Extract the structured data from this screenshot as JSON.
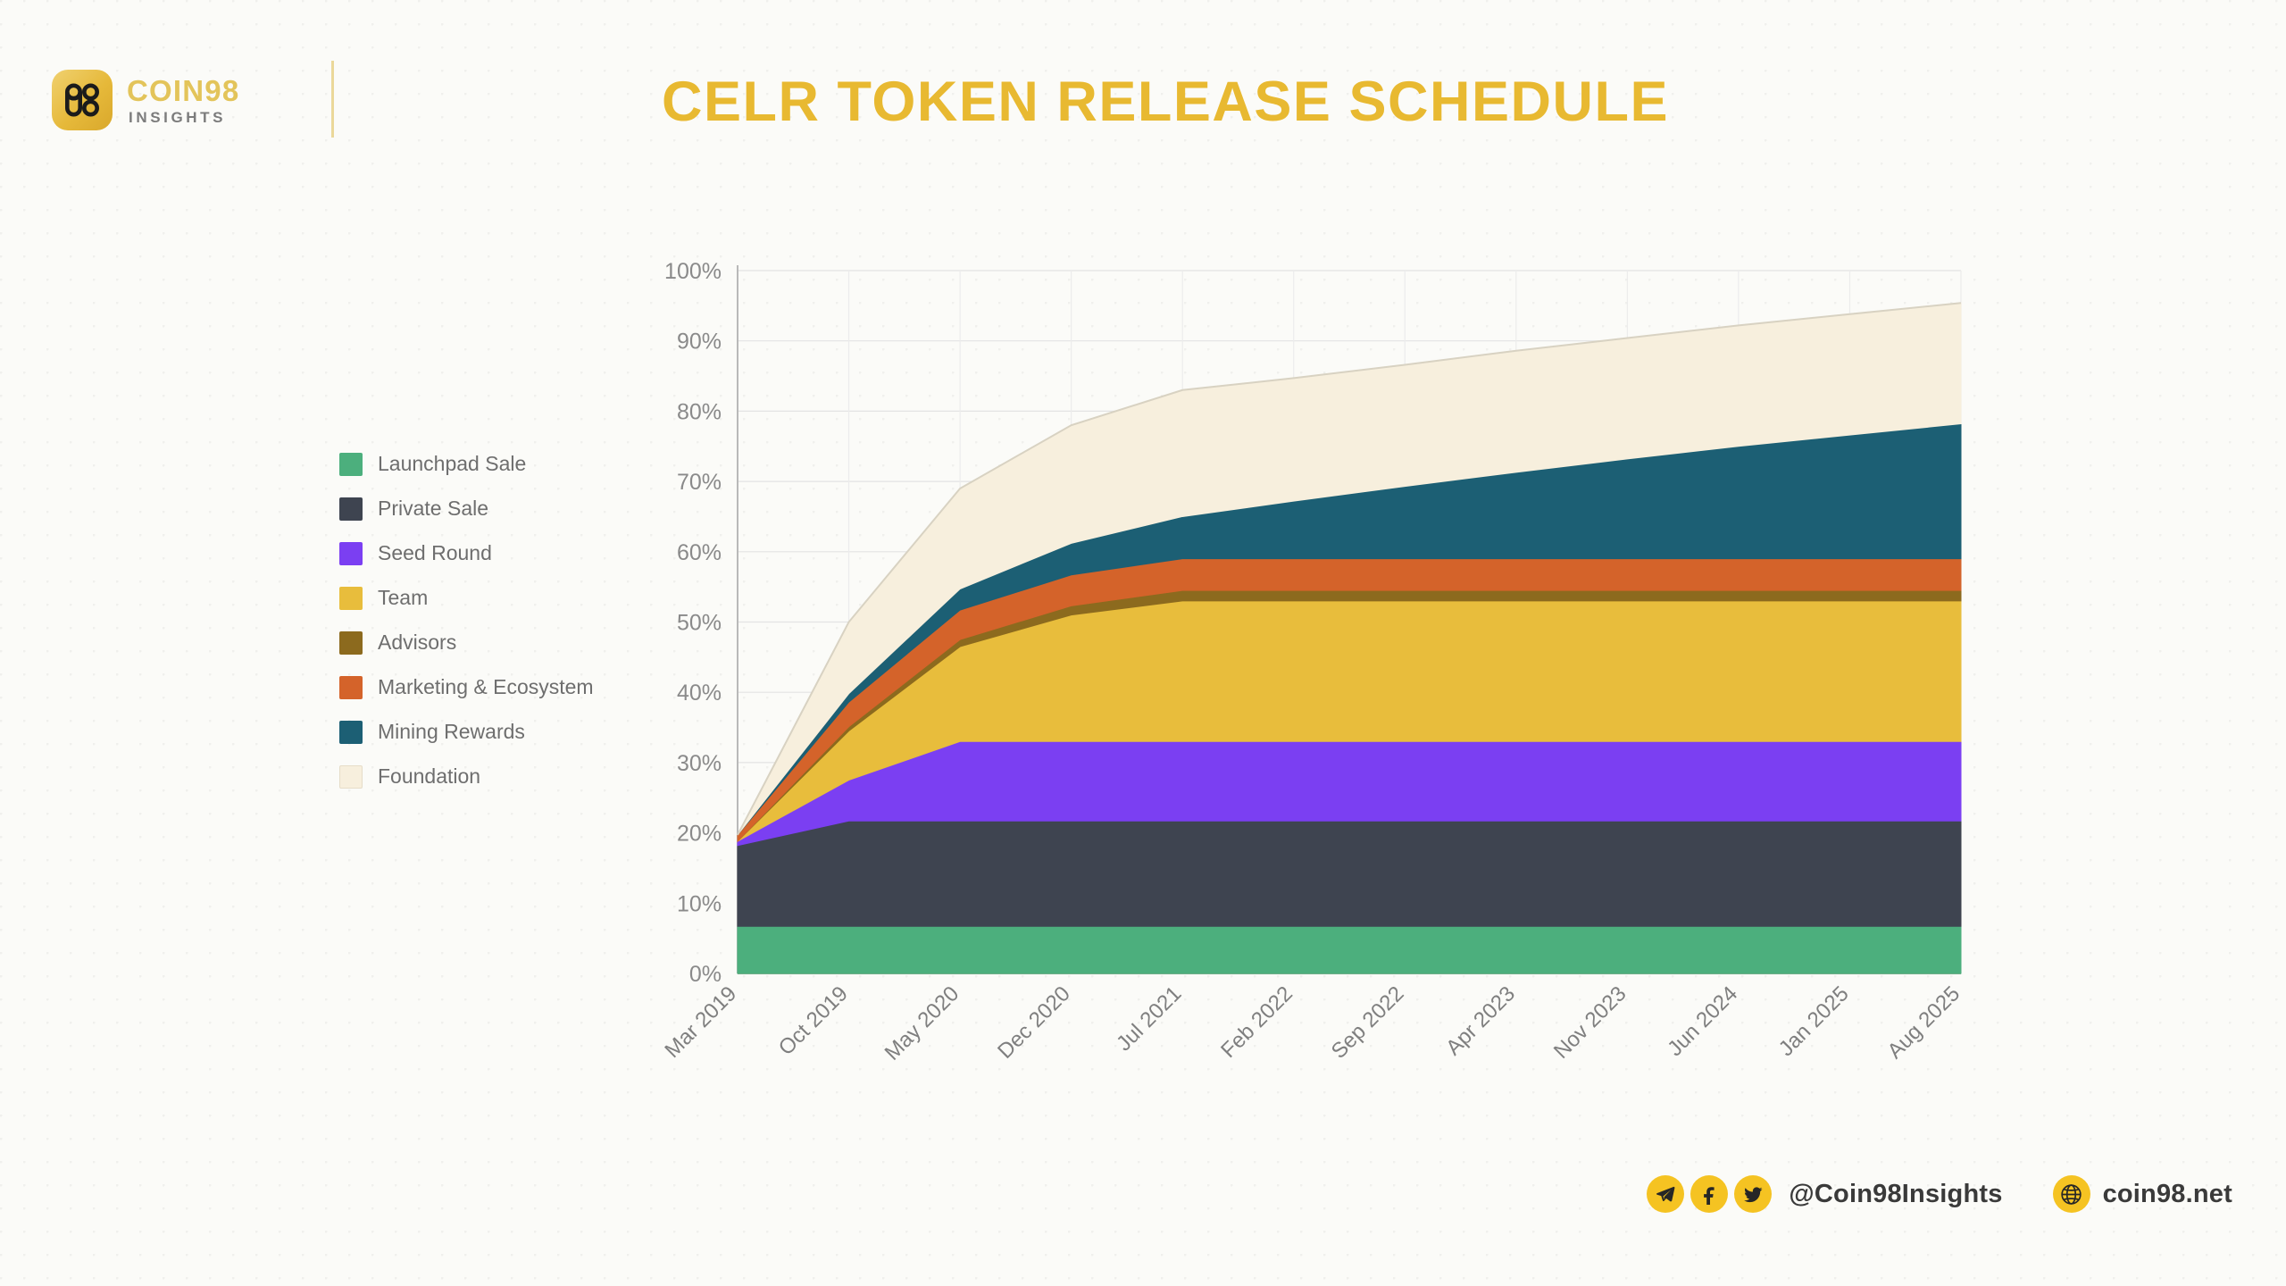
{
  "brand": {
    "mark_icon": "coin98-logo-icon",
    "name": "COIN98",
    "sub": "INSIGHTS"
  },
  "header": {
    "title": "CELR TOKEN RELEASE SCHEDULE",
    "title_color": "#E8B931"
  },
  "legend": {
    "position": "left",
    "items": [
      {
        "label": "Launchpad Sale",
        "color": "#4CAF7D"
      },
      {
        "label": "Private Sale",
        "color": "#3E4450"
      },
      {
        "label": "Seed Round",
        "color": "#7B3FF2"
      },
      {
        "label": "Team",
        "color": "#E8BD3C"
      },
      {
        "label": "Advisors",
        "color": "#8C6A1E"
      },
      {
        "label": "Marketing & Ecosystem",
        "color": "#D4632A"
      },
      {
        "label": "Mining Rewards",
        "color": "#1C5F74"
      },
      {
        "label": "Foundation",
        "color": "#F7EFDD"
      }
    ]
  },
  "footer": {
    "social_icons": [
      {
        "name": "telegram-icon",
        "glyph": "telegram"
      },
      {
        "name": "facebook-icon",
        "glyph": "facebook"
      },
      {
        "name": "twitter-icon",
        "glyph": "twitter"
      }
    ],
    "handle": "@Coin98Insights",
    "globe_icon": "globe-icon",
    "website": "coin98.net",
    "badge_color": "#F5C322"
  },
  "chart_data": {
    "type": "area",
    "stacked": true,
    "title": "CELR TOKEN RELEASE SCHEDULE",
    "xlabel": "",
    "ylabel": "",
    "ylim": [
      0,
      100
    ],
    "yticks": [
      0,
      10,
      20,
      30,
      40,
      50,
      60,
      70,
      80,
      90,
      100
    ],
    "ytick_labels": [
      "0%",
      "10%",
      "20%",
      "30%",
      "40%",
      "50%",
      "60%",
      "70%",
      "80%",
      "90%",
      "100%"
    ],
    "grid": true,
    "legend_position": "left-outside",
    "x": [
      "Mar 2019",
      "Oct 2019",
      "May 2020",
      "Dec 2020",
      "Jul 2021",
      "Feb 2022",
      "Sep 2022",
      "Apr 2023",
      "Nov 2023",
      "Jun 2024",
      "Jan 2025",
      "Aug 2025"
    ],
    "series": [
      {
        "name": "Launchpad Sale",
        "color": "#4CAF7D",
        "values": [
          6.7,
          6.7,
          6.7,
          6.7,
          6.7,
          6.7,
          6.7,
          6.7,
          6.7,
          6.7,
          6.7,
          6.7
        ]
      },
      {
        "name": "Private Sale",
        "color": "#3E4450",
        "values": [
          11.5,
          15.0,
          15.0,
          15.0,
          15.0,
          15.0,
          15.0,
          15.0,
          15.0,
          15.0,
          15.0,
          15.0
        ]
      },
      {
        "name": "Seed Round",
        "color": "#7B3FF2",
        "values": [
          0.6,
          5.8,
          11.3,
          11.3,
          11.3,
          11.3,
          11.3,
          11.3,
          11.3,
          11.3,
          11.3,
          11.3
        ]
      },
      {
        "name": "Team",
        "color": "#E8BD3C",
        "values": [
          0.0,
          7.0,
          13.5,
          18.0,
          20.0,
          20.0,
          20.0,
          20.0,
          20.0,
          20.0,
          20.0,
          20.0
        ]
      },
      {
        "name": "Advisors",
        "color": "#8C6A1E",
        "values": [
          0.0,
          0.6,
          1.0,
          1.3,
          1.5,
          1.5,
          1.5,
          1.5,
          1.5,
          1.5,
          1.5,
          1.5
        ]
      },
      {
        "name": "Marketing & Ecosystem",
        "color": "#D4632A",
        "values": [
          0.9,
          3.5,
          4.2,
          4.4,
          4.5,
          4.5,
          4.5,
          4.5,
          4.5,
          4.5,
          4.5,
          4.5
        ]
      },
      {
        "name": "Mining Rewards",
        "color": "#1C5F74",
        "values": [
          0.0,
          1.2,
          3.0,
          4.5,
          6.0,
          8.2,
          10.3,
          12.3,
          14.2,
          16.0,
          17.6,
          19.2
        ]
      },
      {
        "name": "Foundation",
        "color": "#F7EFDD",
        "values": [
          0.0,
          10.2,
          14.3,
          16.8,
          18.0,
          17.5,
          17.3,
          17.3,
          17.2,
          17.2,
          17.2,
          17.2
        ]
      }
    ],
    "totals": [
      19.7,
      50.0,
      69.0,
      78.0,
      83.0,
      84.7,
      86.6,
      88.6,
      90.4,
      92.2,
      93.8,
      95.4
    ]
  }
}
